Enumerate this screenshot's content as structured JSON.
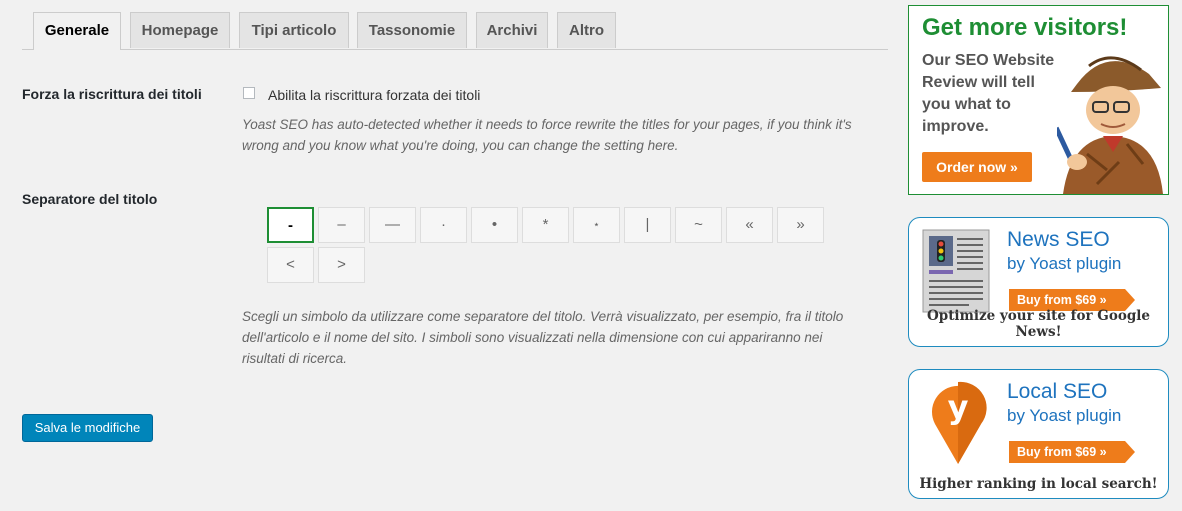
{
  "tabs": [
    {
      "label": "Generale",
      "active": true
    },
    {
      "label": "Homepage"
    },
    {
      "label": "Tipi articolo"
    },
    {
      "label": "Tassonomie"
    },
    {
      "label": "Archivi"
    },
    {
      "label": "Altro"
    }
  ],
  "rewrite": {
    "label": "Forza la riscrittura dei titoli",
    "checkbox_label": "Abilita la riscrittura forzata dei titoli",
    "checked": false,
    "desc_line1": "Yoast SEO has auto-detected whether it needs to force rewrite the titles for your pages, if you think it's",
    "desc_line2": "wrong and you know what you're doing, you can change the setting here."
  },
  "separator": {
    "label": "Separatore del titolo",
    "symbols": [
      "-",
      "–",
      "—",
      "·",
      "•",
      "*",
      "⋆",
      "|",
      "~",
      "«",
      "»",
      "<",
      ">"
    ],
    "selected": "-",
    "desc_line1": "Scegli un simbolo da utilizzare come separatore del titolo. Verrà visualizzato, per esempio, fra il titolo",
    "desc_line2": "dell'articolo e il nome del sito. I simboli sono visualizzati nella dimensione con cui appariranno nei",
    "desc_line3": "risultati di ricerca."
  },
  "save_label": "Salva le modifiche",
  "ads": {
    "visitors": {
      "heading": "Get more visitors!",
      "body": "Our SEO Website Review will tell you what to improve.",
      "button": "Order now »"
    },
    "news": {
      "title": "News SEO",
      "subtitle": "by Yoast plugin",
      "button": "Buy from $69 »",
      "footer": "Optimize your site for Google News!"
    },
    "local": {
      "title": "Local SEO",
      "subtitle": "by Yoast plugin",
      "button": "Buy from $69 »",
      "footer": "Higher ranking in local search!"
    }
  },
  "colors": {
    "accent_green": "#1e8e34",
    "button_blue": "#0085ba",
    "ad_orange": "#ee7c1b",
    "ad_blue": "#1e73be"
  }
}
